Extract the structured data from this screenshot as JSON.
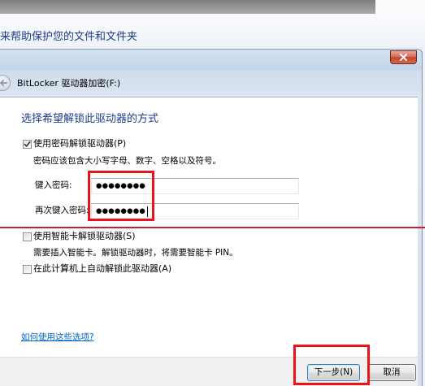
{
  "background_window": {
    "instruction_fragment": "来帮助保护您的文件和文件夹"
  },
  "dialog": {
    "nav_title": "BitLocker 驱动器加密(F:)",
    "heading": "选择希望解锁此驱动器的方式",
    "options": [
      {
        "label": "使用密码解锁驱动器(P)",
        "checked": true,
        "description": "密码应该包含大小写字母、数字、空格以及符号。"
      },
      {
        "label": "使用智能卡解锁驱动器(S)",
        "checked": false,
        "description": "需要插入智能卡。解锁驱动器时，将需要智能卡 PIN。"
      },
      {
        "label": "在此计算机上自动解锁此驱动器(A)",
        "checked": false
      }
    ],
    "password_field": {
      "label": "键入密码:",
      "value": "●●●●●●●●"
    },
    "confirm_field": {
      "label": "再次键入密码:",
      "value": "●●●●●●●●"
    },
    "help_link": "如何使用这些选项?",
    "next_button": "下一步(N)",
    "cancel_button": "取消"
  },
  "icons": {
    "close": "close-icon",
    "back": "back-arrow-icon",
    "checkbox_check": "checkmark-icon"
  },
  "colors": {
    "heading": "#1e3c8c",
    "link": "#0066cc",
    "annotation": "#e8141c",
    "annotation_line": "#c81e2a",
    "close_button": "#c74232"
  }
}
